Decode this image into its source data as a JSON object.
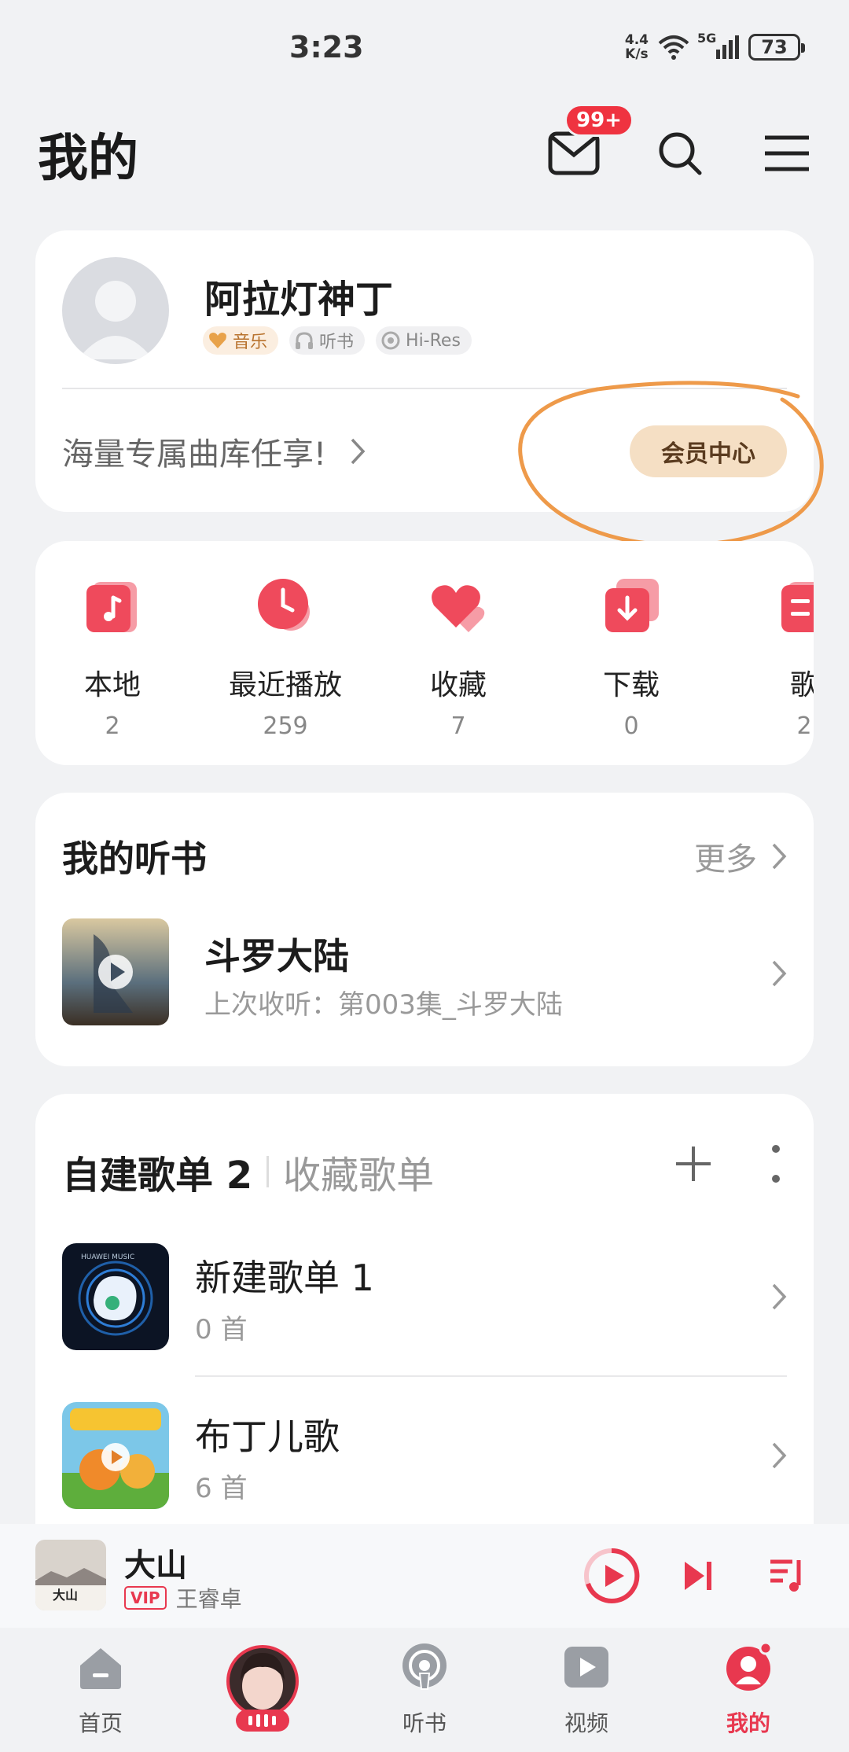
{
  "status_bar": {
    "time": "3:23",
    "net_speed_value": "4.4",
    "net_speed_unit": "K/s",
    "signal": "5G",
    "battery": "73"
  },
  "header": {
    "title": "我的",
    "mail_badge": "99+"
  },
  "profile": {
    "username": "阿拉灯神丁",
    "badges": [
      "音乐",
      "听书",
      "Hi-Res"
    ],
    "promo": "海量专属曲库任享!",
    "vip_button": "会员中心"
  },
  "shortcuts": [
    {
      "label": "本地",
      "count": "2",
      "icon": "music-note-icon",
      "color": "#ef4a5c"
    },
    {
      "label": "最近播放",
      "count": "259",
      "icon": "clock-icon",
      "color": "#ef4a5c"
    },
    {
      "label": "收藏",
      "count": "7",
      "icon": "heart-icon",
      "color": "#ef4a5c"
    },
    {
      "label": "下载",
      "count": "0",
      "icon": "download-icon",
      "color": "#ef4a5c"
    },
    {
      "label": "歌",
      "count": "2",
      "icon": "playlist-icon",
      "color": "#ef4a5c"
    }
  ],
  "audiobook": {
    "title": "我的听书",
    "more": "更多",
    "item": {
      "title": "斗罗大陆",
      "subtitle": "上次收听：第003集_斗罗大陆"
    }
  },
  "playlists": {
    "own_tab": "自建歌单 2",
    "fav_tab": "收藏歌单",
    "items": [
      {
        "name": "新建歌单 1",
        "count": "0 首"
      },
      {
        "name": "布丁儿歌",
        "count": "6 首"
      }
    ]
  },
  "now_playing": {
    "title": "大山",
    "vip": "VIP",
    "artist": "王睿卓"
  },
  "bottom_nav": [
    {
      "label": "首页",
      "icon": "home-icon"
    },
    {
      "label": "",
      "icon": "avatar-play-icon"
    },
    {
      "label": "听书",
      "icon": "podcast-icon"
    },
    {
      "label": "视频",
      "icon": "video-icon"
    },
    {
      "label": "我的",
      "icon": "profile-icon",
      "active": true
    }
  ],
  "colors": {
    "accent": "#e8384f",
    "background": "#f1f2f4",
    "vip_button_bg": "#f5dfc4",
    "annotation": "#ee9a4a"
  }
}
